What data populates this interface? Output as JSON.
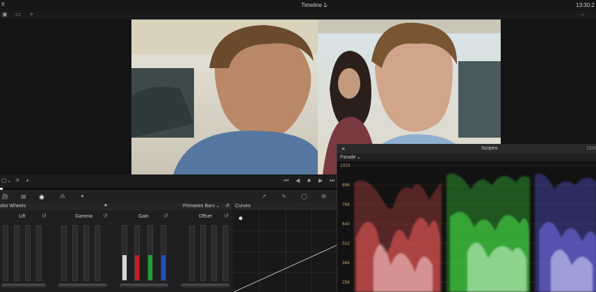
{
  "topbar": {
    "left_label": "ft",
    "title": "Timeline 1",
    "timecode": "13:30:2"
  },
  "colors": {
    "accent_red": "#e05050",
    "accent_green": "#40e040",
    "accent_blue": "#6060ff",
    "scale_label": "#c9a66b"
  },
  "wheels": {
    "header_left": "olor Wheels",
    "dropdown": "Primaries Bars",
    "columns": [
      "Lift",
      "Gamma",
      "Gain",
      "Offset"
    ]
  },
  "curves": {
    "title": "Curves"
  },
  "scopes": {
    "title": "Scopes",
    "close": "×",
    "ratio": "16x9",
    "mode": "Parade",
    "scale": [
      "1023",
      "896",
      "768",
      "640",
      "512",
      "384",
      "256"
    ]
  },
  "icons": {
    "palette": [
      "camera-icon",
      "image-icon",
      "target-icon",
      "nodes-icon",
      "sparkle-icon",
      "curve-icon",
      "pen-icon",
      "circle-icon",
      "gear-icon"
    ]
  }
}
